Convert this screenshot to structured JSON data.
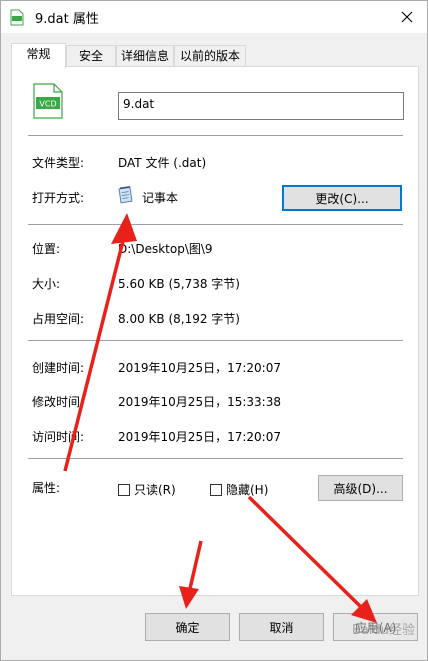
{
  "window": {
    "title": "9.dat 属性",
    "close_glyph": "✕"
  },
  "tabs": [
    {
      "label": "常规",
      "active": true
    },
    {
      "label": "安全",
      "active": false
    },
    {
      "label": "详细信息",
      "active": false
    },
    {
      "label": "以前的版本",
      "active": false
    }
  ],
  "file": {
    "icon_text": "VCD",
    "name": "9.dat"
  },
  "type_section": {
    "type_label": "文件类型:",
    "type_value": "DAT 文件 (.dat)",
    "open_label": "打开方式:",
    "open_value": "记事本",
    "change_button": "更改(C)..."
  },
  "location_section": {
    "location_label": "位置:",
    "location_value": "D:\\Desktop\\图\\9",
    "size_label": "大小:",
    "size_value": "5.60 KB (5,738 字节)",
    "disk_label": "占用空间:",
    "disk_value": "8.00 KB (8,192 字节)"
  },
  "time_section": {
    "created_label": "创建时间:",
    "created_value": "2019年10月25日，17:20:07",
    "modified_label": "修改时间:",
    "modified_value": "2019年10月25日，15:33:38",
    "accessed_label": "访问时间:",
    "accessed_value": "2019年10月25日，17:20:07"
  },
  "attributes": {
    "label": "属性:",
    "readonly_label": "只读(R)",
    "hidden_label": "隐藏(H)",
    "advanced_button": "高级(D)..."
  },
  "footer": {
    "ok_button": "确定",
    "cancel_button": "取消",
    "apply_button": "应用(A)"
  },
  "watermark": "Baidu经验",
  "colors": {
    "arrow": "#e8221b",
    "icon_green": "#3aa845",
    "focus_blue": "#0078d7"
  }
}
